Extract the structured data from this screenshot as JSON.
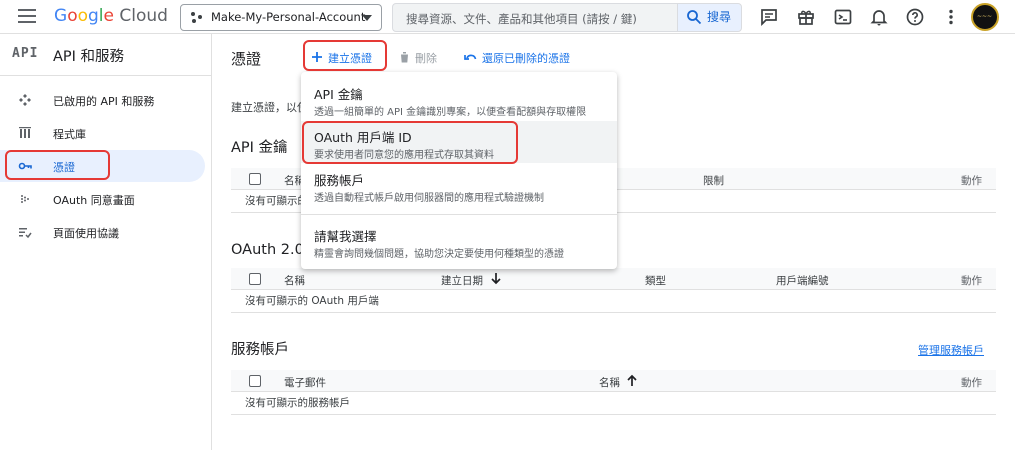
{
  "topbar": {
    "logo_google": "Google",
    "logo_cloud": "Cloud",
    "project_name": "Make-My-Personal-Account",
    "search_placeholder": "搜尋資源、文件、產品和其他項目 (請按 / 鍵)",
    "search_button": "搜尋",
    "icons": [
      "menu-icon",
      "project-icon",
      "search-icon",
      "feedback-icon",
      "gift-icon",
      "terminal-icon",
      "notification-icon",
      "help-icon",
      "more-vert-icon",
      "avatar"
    ]
  },
  "sidebar": {
    "api_mark": "API",
    "title": "API 和服務",
    "items": [
      {
        "label": "已啟用的 API 和服務",
        "icon": "diamond-icon"
      },
      {
        "label": "程式庫",
        "icon": "library-icon"
      },
      {
        "label": "憑證",
        "icon": "key-icon",
        "active": true
      },
      {
        "label": "OAuth 同意畫面",
        "icon": "consent-icon"
      },
      {
        "label": "頁面使用協議",
        "icon": "agreement-icon"
      }
    ]
  },
  "main": {
    "title": "憑證",
    "actions": {
      "create": "建立憑證",
      "delete": "刪除",
      "restore": "還原已刪除的憑證"
    },
    "hint": "建立憑證，以使",
    "api_keys": {
      "title": "API 金鑰",
      "headers": {
        "name": "名稱",
        "restriction": "限制",
        "action": "動作"
      },
      "empty": "沒有可顯示的"
    },
    "oauth": {
      "title": "OAuth 2.0 用",
      "headers": {
        "name": "名稱",
        "date": "建立日期",
        "type": "類型",
        "client_id": "用戶端編號",
        "action": "動作"
      },
      "empty": "沒有可顯示的 OAuth 用戶端"
    },
    "service_accounts": {
      "title": "服務帳戶",
      "manage_link": "管理服務帳戶",
      "headers": {
        "email": "電子郵件",
        "name": "名稱",
        "action": "動作"
      },
      "empty": "沒有可顯示的服務帳戶"
    }
  },
  "dropdown": {
    "items": [
      {
        "title": "API 金鑰",
        "desc": "透過一組簡單的 API 金鑰識別專案，以便查看配額與存取權限"
      },
      {
        "title": "OAuth 用戶端 ID",
        "desc": "要求使用者同意您的應用程式存取其資料",
        "highlighted": true
      },
      {
        "title": "服務帳戶",
        "desc": "透過自動程式帳戶啟用伺服器間的應用程式驗證機制"
      },
      {
        "title": "請幫我選擇",
        "desc": "精靈會詢問幾個問題，協助您決定要使用何種類型的憑證"
      }
    ]
  },
  "colors": {
    "accent": "#1a73e8",
    "annotation_red": "#e53935",
    "active_bg": "#e8f0fe"
  }
}
